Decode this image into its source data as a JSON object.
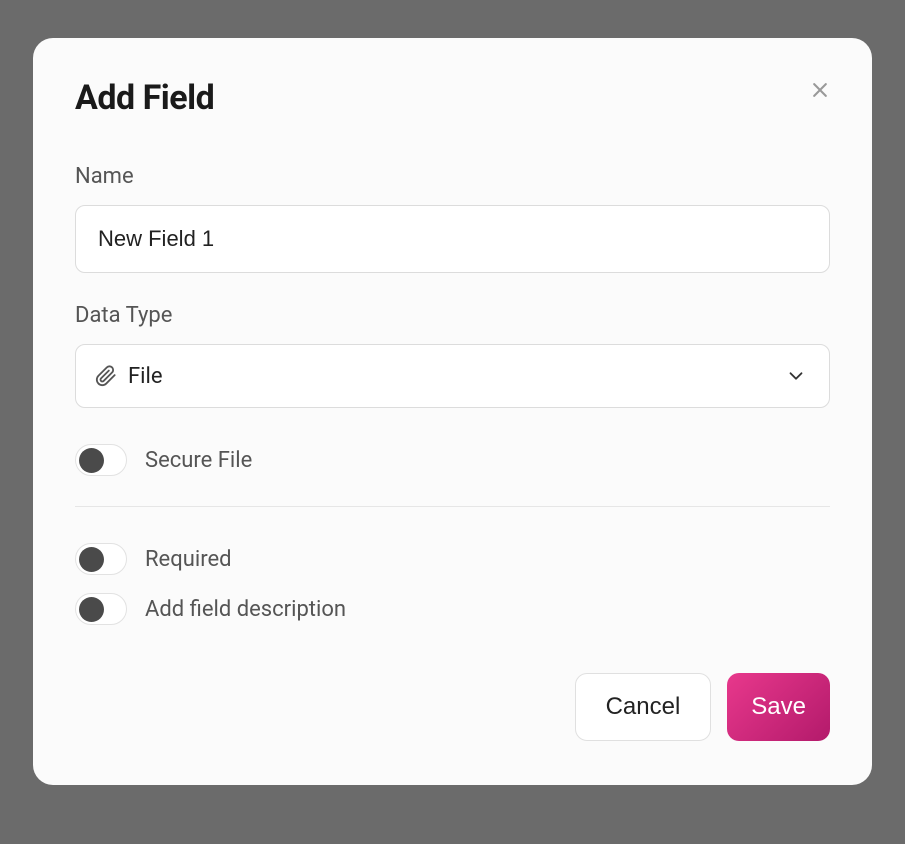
{
  "modal": {
    "title": "Add Field",
    "name": {
      "label": "Name",
      "value": "New Field 1"
    },
    "data_type": {
      "label": "Data Type",
      "value": "File"
    },
    "secure_file": {
      "label": "Secure File"
    },
    "required": {
      "label": "Required"
    },
    "add_description": {
      "label": "Add field description"
    },
    "buttons": {
      "cancel": "Cancel",
      "save": "Save"
    }
  }
}
